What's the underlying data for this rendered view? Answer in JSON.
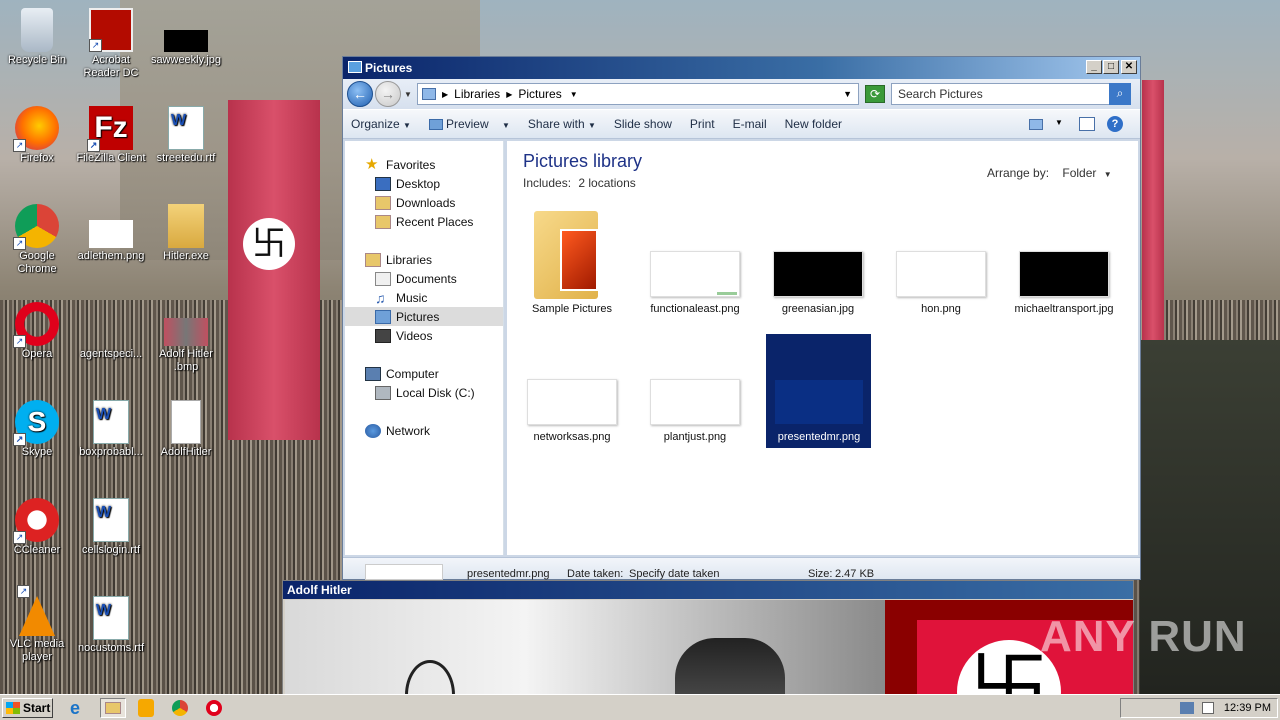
{
  "desktop": {
    "icons": [
      {
        "label": "Recycle Bin"
      },
      {
        "label": "Acrobat Reader DC"
      },
      {
        "label": "sawweekly.jpg"
      },
      {
        "label": "Firefox"
      },
      {
        "label": "FileZilla Client"
      },
      {
        "label": "streetedu.rtf"
      },
      {
        "label": "Google Chrome"
      },
      {
        "label": "adlethem.png"
      },
      {
        "label": "Hitler.exe"
      },
      {
        "label": "Opera"
      },
      {
        "label": "agentspeci..."
      },
      {
        "label": "Adolf Hitler .bmp"
      },
      {
        "label": "Skype"
      },
      {
        "label": "boxprobabl..."
      },
      {
        "label": "AdolfHitler"
      },
      {
        "label": "CCleaner"
      },
      {
        "label": "cellslogin.rtf"
      },
      {
        "label": "VLC media player"
      },
      {
        "label": "nocustoms.rtf"
      }
    ]
  },
  "explorer": {
    "title": "Pictures",
    "address": {
      "crumb1": "Libraries",
      "crumb2": "Pictures"
    },
    "search_placeholder": "Search Pictures",
    "toolbar": {
      "organize": "Organize",
      "preview": "Preview",
      "share_with": "Share with",
      "slide_show": "Slide show",
      "print": "Print",
      "email": "E-mail",
      "new_folder": "New folder"
    },
    "nav": {
      "favorites": "Favorites",
      "desktop": "Desktop",
      "downloads": "Downloads",
      "recent_places": "Recent Places",
      "libraries": "Libraries",
      "documents": "Documents",
      "music": "Music",
      "pictures": "Pictures",
      "videos": "Videos",
      "computer": "Computer",
      "local_disk": "Local Disk (C:)",
      "network": "Network"
    },
    "content": {
      "heading": "Pictures library",
      "includes_label": "Includes:",
      "includes_value": "2 locations",
      "arrange_label": "Arrange by:",
      "arrange_value": "Folder"
    },
    "items": [
      {
        "name": "Sample Pictures"
      },
      {
        "name": "functionaleast.png"
      },
      {
        "name": "greenasian.jpg"
      },
      {
        "name": "hon.png"
      },
      {
        "name": "michaeltransport.jpg"
      },
      {
        "name": "networksas.png"
      },
      {
        "name": "plantjust.png"
      },
      {
        "name": "presentedmr.png"
      }
    ],
    "status": {
      "filename": "presentedmr.png",
      "date_label": "Date taken:",
      "date_value": "Specify date taken",
      "size_label": "Size:",
      "size_value": "2.47 KB"
    }
  },
  "image_window": {
    "title": "Adolf Hitler"
  },
  "taskbar": {
    "start": "Start",
    "clock": "12:39 PM"
  },
  "watermark": "ANY RUN"
}
